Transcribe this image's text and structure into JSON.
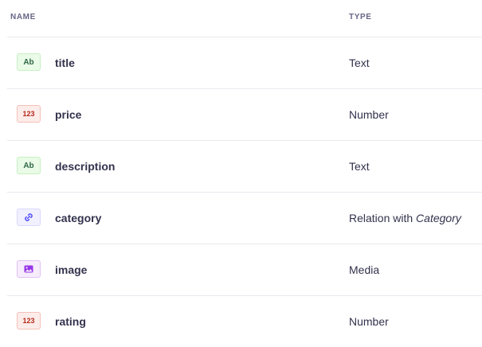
{
  "table": {
    "columns": {
      "name": "NAME",
      "type": "TYPE"
    },
    "rows": [
      {
        "badge": "Ab",
        "badge_kind": "text",
        "name": "title",
        "type": "Text",
        "type_target": ""
      },
      {
        "badge": "123",
        "badge_kind": "number",
        "name": "price",
        "type": "Number",
        "type_target": ""
      },
      {
        "badge": "Ab",
        "badge_kind": "text",
        "name": "description",
        "type": "Text",
        "type_target": ""
      },
      {
        "badge": "link-icon",
        "badge_kind": "relation",
        "name": "category",
        "type": "Relation with",
        "type_target": "Category"
      },
      {
        "badge": "image-icon",
        "badge_kind": "media",
        "name": "image",
        "type": "Media",
        "type_target": ""
      },
      {
        "badge": "123",
        "badge_kind": "number",
        "name": "rating",
        "type": "Number",
        "type_target": ""
      }
    ]
  },
  "colors": {
    "text_badge_bg": "#eafbe7",
    "number_badge_bg": "#fcecea",
    "relation_badge_bg": "#f0f0ff",
    "media_badge_bg": "#f6ecfc",
    "divider": "#eaeaef"
  }
}
